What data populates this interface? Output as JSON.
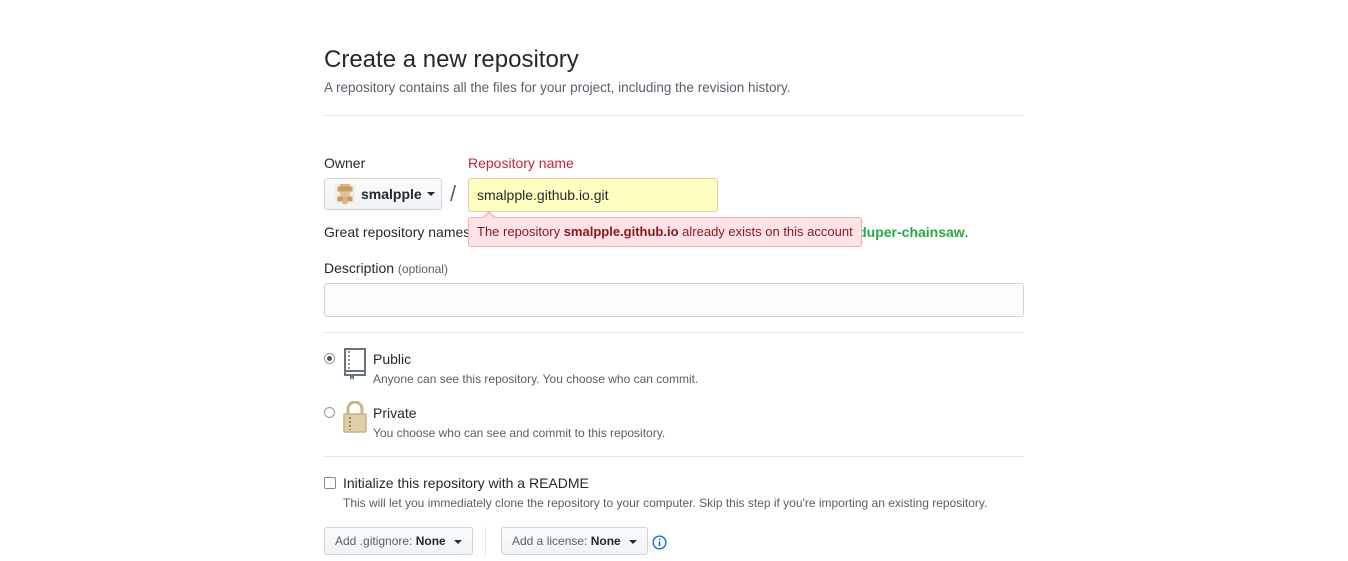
{
  "header": {
    "title": "Create a new repository",
    "subtitle": "A repository contains all the files for your project, including the revision history."
  },
  "owner": {
    "label": "Owner",
    "name": "smalpple"
  },
  "separator": "/",
  "repo": {
    "label": "Repository name",
    "value": "smalpple.github.io.git",
    "hint_prefix": "Great repository names",
    "hint_suffix": "r-duper-chainsaw",
    "hint_end": "."
  },
  "error": {
    "prefix": "The repository ",
    "name": "smalpple.github.io",
    "suffix": " already exists on this account"
  },
  "description": {
    "label": "Description",
    "optional": "(optional)",
    "value": ""
  },
  "visibility": {
    "public": {
      "title": "Public",
      "desc": "Anyone can see this repository. You choose who can commit.",
      "checked": true
    },
    "private": {
      "title": "Private",
      "desc": "You choose who can see and commit to this repository.",
      "checked": false
    }
  },
  "readme": {
    "title": "Initialize this repository with a README",
    "desc": "This will let you immediately clone the repository to your computer. Skip this step if you're importing an existing repository.",
    "checked": false
  },
  "gitignore": {
    "label": "Add .gitignore:",
    "value": "None"
  },
  "license": {
    "label": "Add a license:",
    "value": "None"
  },
  "icons": {
    "public": "repo-book-icon",
    "private": "lock-icon",
    "info": "info-icon"
  },
  "colors": {
    "error_text": "#cb2431",
    "input_error_bg": "#ffffc2",
    "tooltip_bg": "#ffe3e6",
    "link_green": "#28a745",
    "info_blue": "#0366d6"
  }
}
